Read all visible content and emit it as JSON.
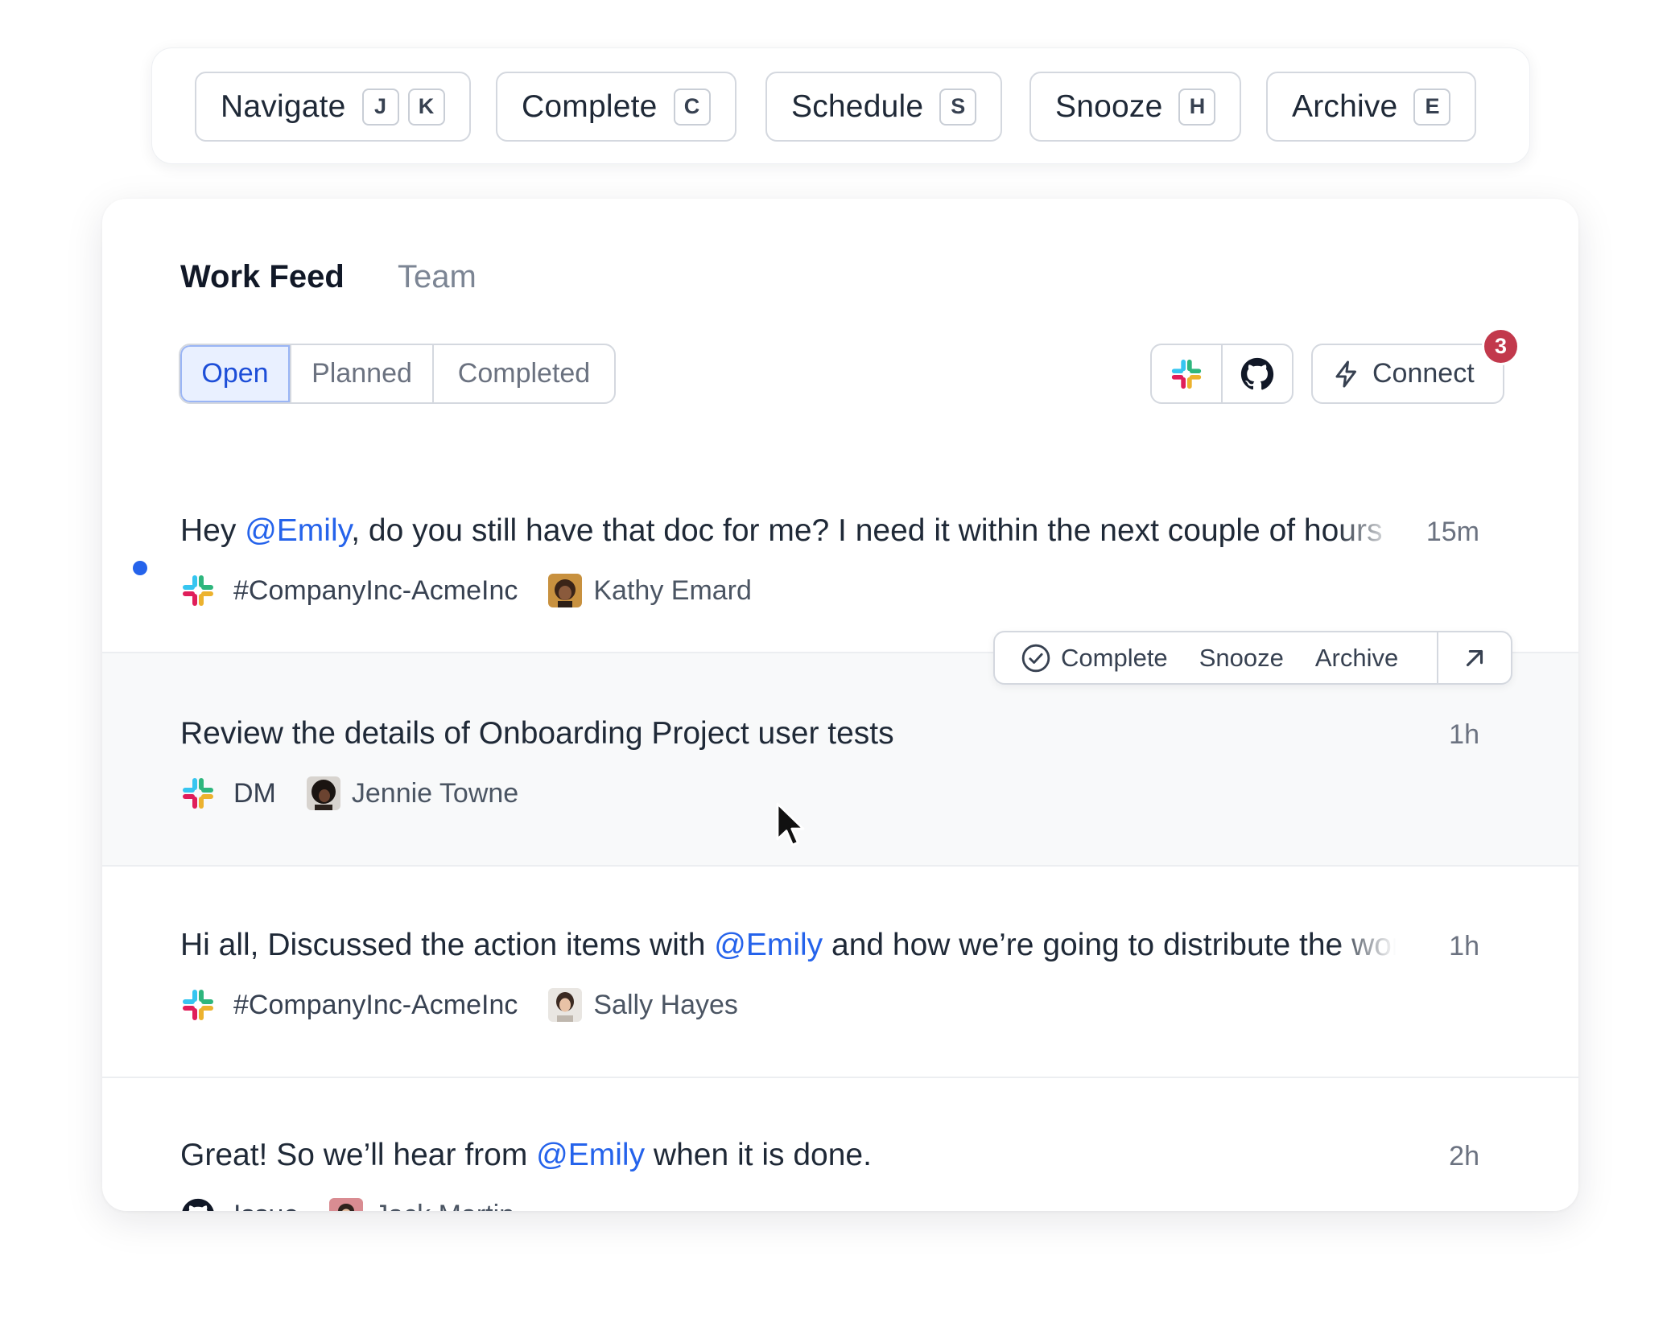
{
  "shortcuts": [
    {
      "label": "Navigate",
      "keys": [
        "J",
        "K"
      ]
    },
    {
      "label": "Complete",
      "keys": [
        "C"
      ]
    },
    {
      "label": "Schedule",
      "keys": [
        "S"
      ]
    },
    {
      "label": "Snooze",
      "keys": [
        "H"
      ]
    },
    {
      "label": "Archive",
      "keys": [
        "E"
      ]
    }
  ],
  "tabs": {
    "work_feed": "Work Feed",
    "team": "Team"
  },
  "filters": {
    "open": "Open",
    "planned": "Planned",
    "completed": "Completed",
    "selected": "Open"
  },
  "integrations": {
    "slack_icon": "slack-icon",
    "github_icon": "github-icon"
  },
  "connect": {
    "label": "Connect",
    "badge": "3",
    "icon": "bolt-icon"
  },
  "colors": {
    "accent": "#2563eb",
    "badge": "#c2394c",
    "selected_bg": "#e9f0ff"
  },
  "hover_actions": {
    "complete": "Complete",
    "snooze": "Snooze",
    "archive": "Archive",
    "open_icon": "arrow-up-right-icon"
  },
  "feed_items": [
    {
      "text_before": "Hey ",
      "mention": "@Emily",
      "text_after": ", do you still have that doc for me? I need it within the next couple of hours",
      "time": "15m",
      "source_icon": "slack-icon",
      "channel": "#CompanyInc-AcmeInc",
      "person": "Kathy Emard",
      "unread": true
    },
    {
      "text_before": "Review the details of Onboarding Project user tests",
      "mention": "",
      "text_after": "",
      "time": "1h",
      "source_icon": "slack-icon",
      "channel": "DM",
      "person": "Jennie Towne",
      "unread": false
    },
    {
      "text_before": "Hi all, Discussed the action items with ",
      "mention": "@Emily",
      "text_after": " and how we’re going to distribute the work",
      "time": "1h",
      "source_icon": "slack-icon",
      "channel": "#CompanyInc-AcmeInc",
      "person": "Sally Hayes",
      "unread": false
    },
    {
      "text_before": "Great! So we’ll hear from ",
      "mention": "@Emily",
      "text_after": " when it is done.",
      "time": "2h",
      "source_icon": "github-icon",
      "channel": "Issue",
      "person": "Jack Martin",
      "unread": false
    }
  ]
}
